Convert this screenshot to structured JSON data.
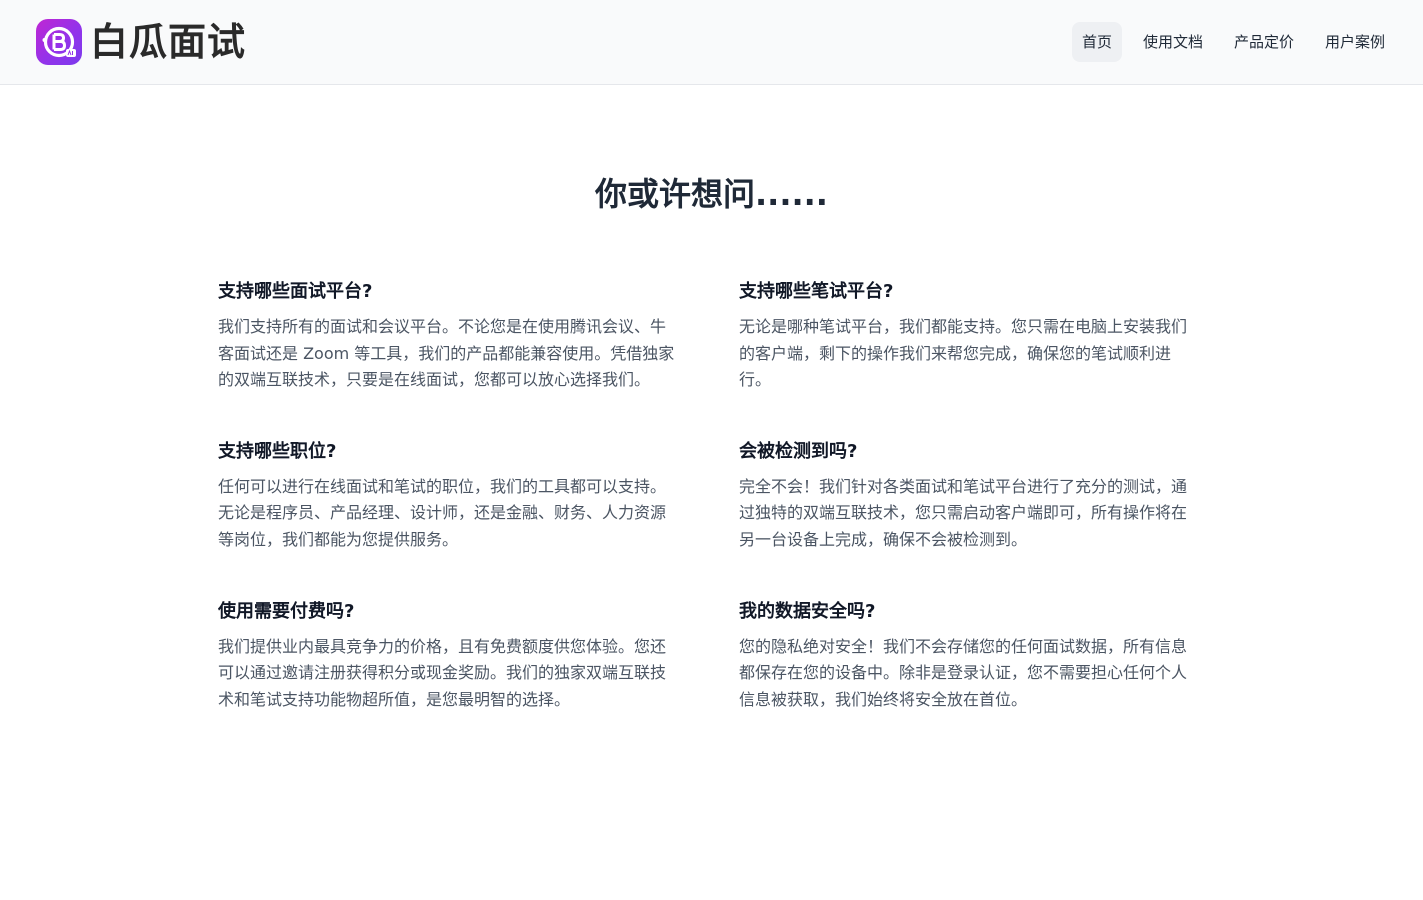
{
  "header": {
    "brand_name": "白瓜面试",
    "logo_icon": "baigua-logo-icon",
    "nav": [
      {
        "label": "首页",
        "active": true
      },
      {
        "label": "使用文档",
        "active": false
      },
      {
        "label": "产品定价",
        "active": false
      },
      {
        "label": "用户案例",
        "active": false
      }
    ]
  },
  "faq": {
    "title": "你或许想问......",
    "items": [
      {
        "question": "支持哪些面试平台?",
        "answer": "我们支持所有的面试和会议平台。不论您是在使用腾讯会议、牛客面试还是 Zoom 等工具，我们的产品都能兼容使用。凭借独家的双端互联技术，只要是在线面试，您都可以放心选择我们。"
      },
      {
        "question": "支持哪些笔试平台?",
        "answer": "无论是哪种笔试平台，我们都能支持。您只需在电脑上安装我们的客户端，剩下的操作我们来帮您完成，确保您的笔试顺利进行。"
      },
      {
        "question": "支持哪些职位?",
        "answer": "任何可以进行在线面试和笔试的职位，我们的工具都可以支持。无论是程序员、产品经理、设计师，还是金融、财务、人力资源等岗位，我们都能为您提供服务。"
      },
      {
        "question": "会被检测到吗?",
        "answer": "完全不会！我们针对各类面试和笔试平台进行了充分的测试，通过独特的双端互联技术，您只需启动客户端即可，所有操作将在另一台设备上完成，确保不会被检测到。"
      },
      {
        "question": "使用需要付费吗?",
        "answer": "我们提供业内最具竞争力的价格，且有免费额度供您体验。您还可以通过邀请注册获得积分或现金奖励。我们的独家双端互联技术和笔试支持功能物超所值，是您最明智的选择。"
      },
      {
        "question": "我的数据安全吗?",
        "answer": "您的隐私绝对安全！我们不会存储您的任何面试数据，所有信息都保存在您的设备中。除非是登录认证，您不需要担心任何个人信息被获取，我们始终将安全放在首位。"
      }
    ]
  }
}
